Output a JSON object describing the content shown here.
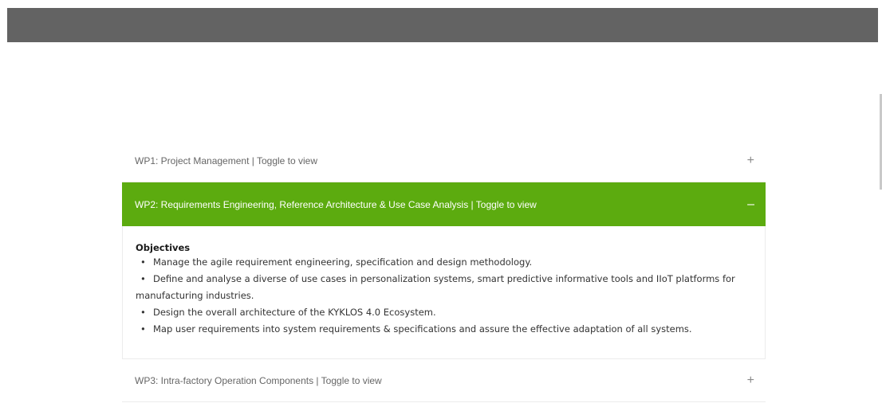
{
  "accordion": {
    "items": [
      {
        "title": "WP1: Project Management | Toggle to view",
        "toggle": "+",
        "expanded": false
      },
      {
        "title": "WP2: Requirements Engineering, Reference Architecture & Use Case Analysis | Toggle to view",
        "toggle": "–",
        "expanded": true,
        "body": {
          "heading": "Objectives",
          "bullet_char": "•",
          "bullets": [
            "Manage the agile requirement engineering, specification and design methodology.",
            "Define and analyse a diverse of use cases in personalization systems, smart predictive informative tools and IIoT platforms for manufacturing industries.",
            "Design the overall architecture of the KYKLOS 4.0 Ecosystem.",
            "Map user requirements into system requirements & specifications and assure the effective adaptation of all systems."
          ]
        }
      },
      {
        "title": "WP3: Intra-factory Operation Components | Toggle to view",
        "toggle": "+",
        "expanded": false
      }
    ]
  },
  "colors": {
    "active_header": "#5cab0f",
    "top_bar": "#636363"
  }
}
